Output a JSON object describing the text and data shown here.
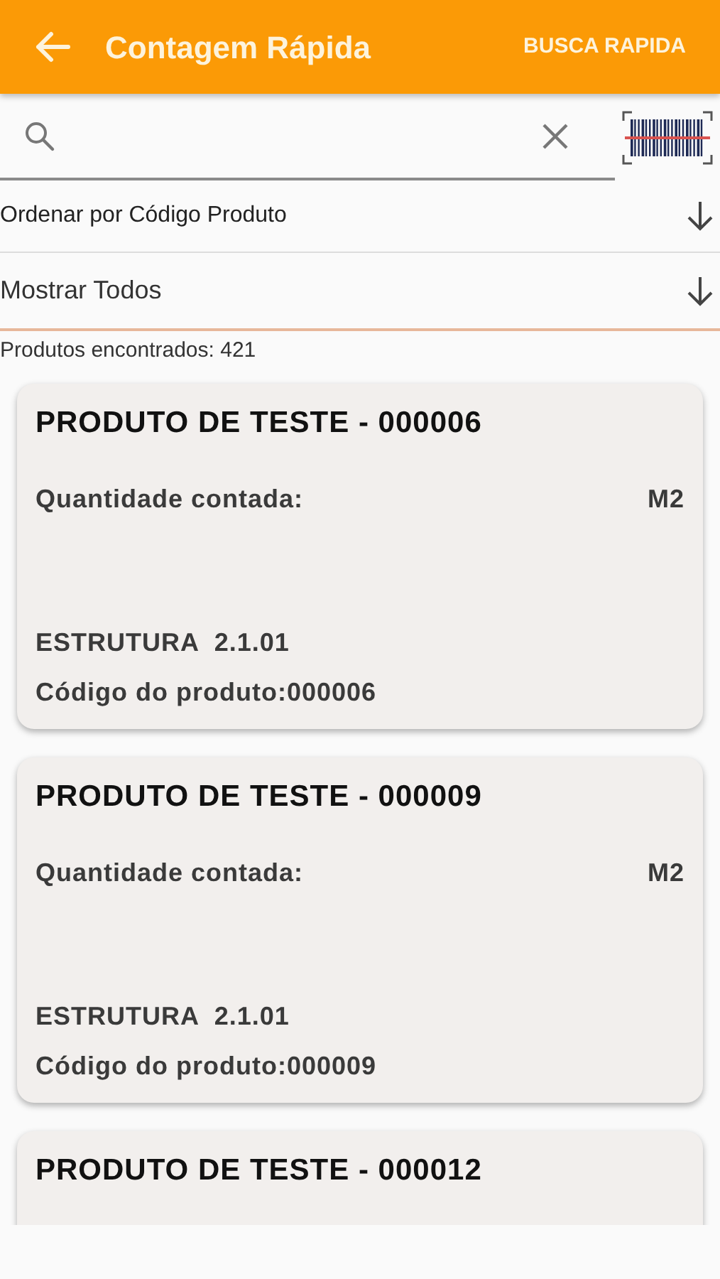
{
  "app_bar": {
    "title": "Contagem Rápida",
    "action": "BUSCA RAPIDA"
  },
  "sort": {
    "label": "Ordenar por Código Produto"
  },
  "filter": {
    "label": "Mostrar Todos"
  },
  "count": "Produtos encontrados: 421",
  "products": [
    {
      "title": "PRODUTO DE TESTE - 000006",
      "quantity_label": "Quantidade contada:",
      "unit": "M2",
      "structure": "ESTRUTURA  2.1.01",
      "code": "Código do produto:000006"
    },
    {
      "title": "PRODUTO DE TESTE - 000009",
      "quantity_label": "Quantidade contada:",
      "unit": "M2",
      "structure": "ESTRUTURA  2.1.01",
      "code": "Código do produto:000009"
    },
    {
      "title": "PRODUTO DE TESTE - 000012"
    }
  ]
}
